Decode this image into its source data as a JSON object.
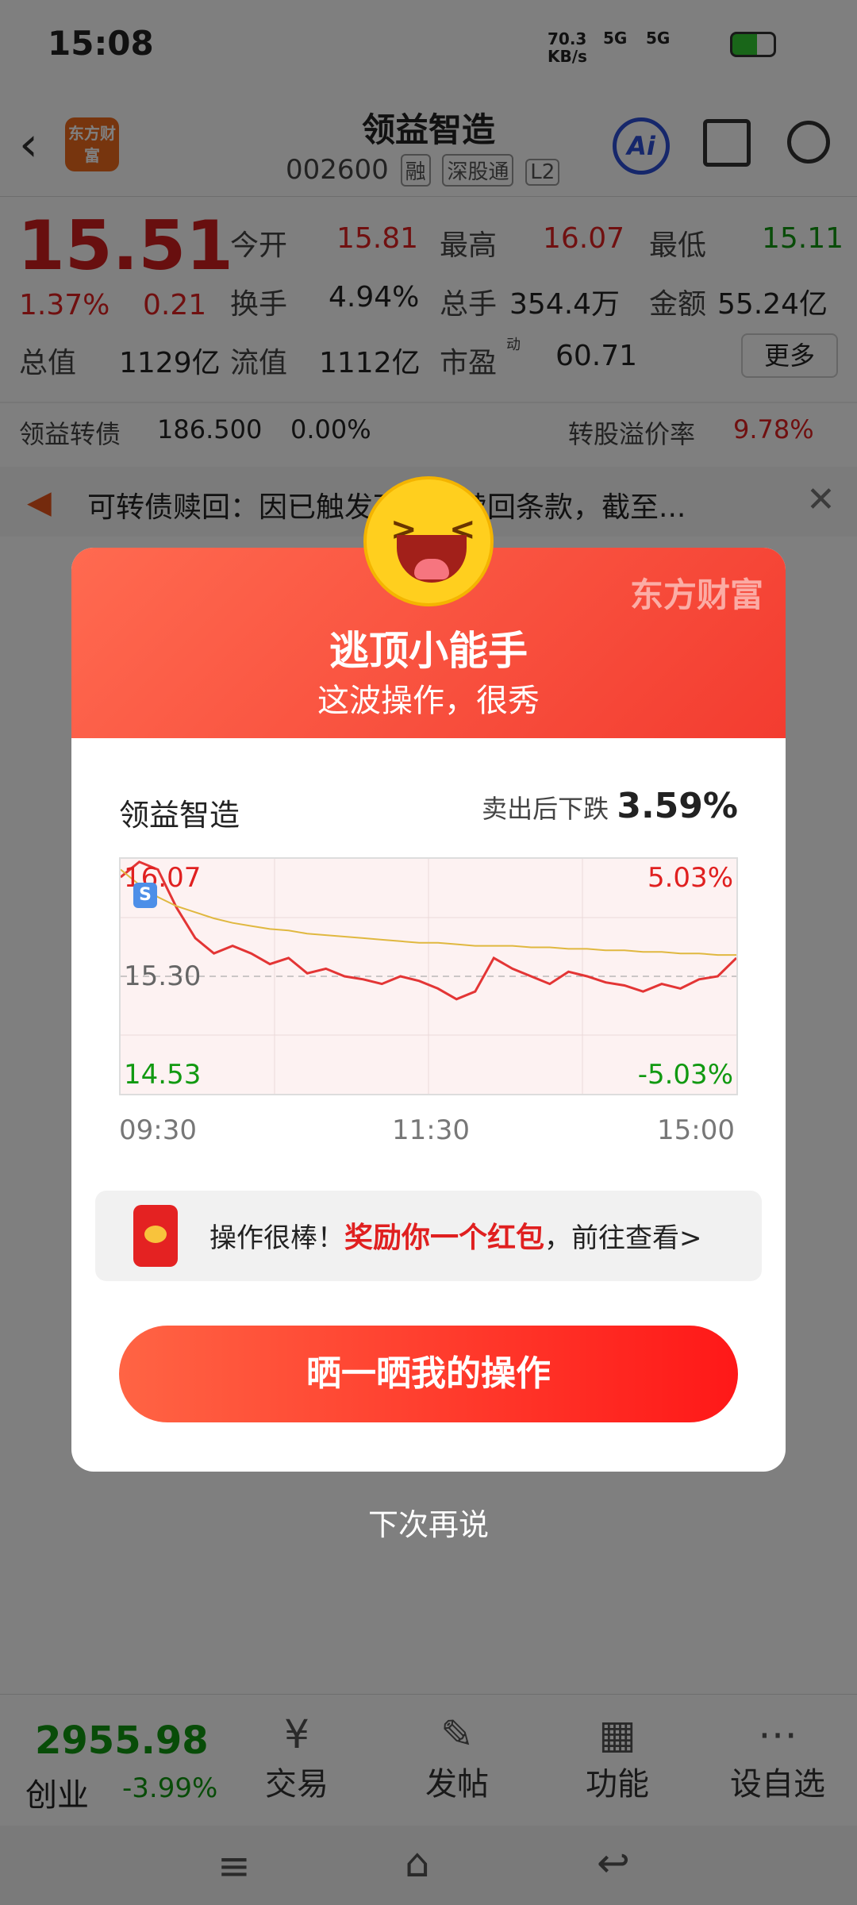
{
  "status_bar": {
    "time": "15:08",
    "net_speed": "70.3 KB/s",
    "sig1": "5G",
    "sig2": "5G"
  },
  "header": {
    "logo": "东方财富",
    "stock_name": "领益智造",
    "stock_code": "002600",
    "tags": [
      "融",
      "深股通",
      "L2"
    ],
    "ai_label": "Ai"
  },
  "quote": {
    "price": "15.51",
    "pct": "1.37%",
    "chg": "0.21",
    "open_label": "今开",
    "open": "15.81",
    "high_label": "最高",
    "high": "16.07",
    "low_label": "最低",
    "low": "15.11",
    "turnover_label": "换手",
    "turnover": "4.94%",
    "vol_label": "总手",
    "vol": "354.4万",
    "amount_label": "金额",
    "amount": "55.24亿",
    "mktcap_label": "总值",
    "mktcap": "1129亿",
    "float_label": "流值",
    "float": "1112亿",
    "pe_label": "市盈",
    "pe_sup": "动",
    "pe": "60.71",
    "more": "更多"
  },
  "bond": {
    "label": "领益转债",
    "price": "186.500",
    "pct": "0.00%",
    "prem_label": "转股溢价率",
    "prem": "9.78%"
  },
  "notice": {
    "text": "可转债赎回：因已触发可转债赎回条款，截至..."
  },
  "modal": {
    "brand": "东方财富",
    "title": "逃顶小能手",
    "subtitle": "这波操作，很秀",
    "stock": "领益智造",
    "drop_label": "卖出后下跌",
    "drop_value": "3.59%",
    "chart_high": "16.07",
    "chart_low": "14.53",
    "chart_high_pct": "5.03%",
    "chart_low_pct": "-5.03%",
    "chart_mid": "15.30",
    "chart_marker": "S",
    "times": [
      "09:30",
      "11:30",
      "15:00"
    ],
    "hint_pre": "操作很棒！",
    "hint_highlight": "奖励你一个红包",
    "hint_post": "，前往查看>",
    "share_button": "晒一晒我的操作",
    "later": "下次再说"
  },
  "nav": {
    "index_value": "2955.98",
    "index_name": "创业",
    "index_pct": "-3.99%",
    "items": [
      "交易",
      "发帖",
      "功能",
      "设自选"
    ]
  },
  "chart_data": {
    "type": "line",
    "x_labels": [
      "09:30",
      "11:30",
      "15:00"
    ],
    "ylim": [
      14.53,
      16.07
    ],
    "series": [
      {
        "values": [
          15.95,
          16.05,
          16.0,
          15.75,
          15.55,
          15.45,
          15.5,
          15.45,
          15.38,
          15.42,
          15.32,
          15.35,
          15.3,
          15.28,
          15.25,
          15.3,
          15.27,
          15.22,
          15.15,
          15.2,
          15.42,
          15.35,
          15.3,
          15.25,
          15.33,
          15.3,
          15.26,
          15.24,
          15.2,
          15.25,
          15.22,
          15.28,
          15.3,
          15.42
        ]
      },
      {
        "values": [
          16.0,
          15.9,
          15.82,
          15.76,
          15.72,
          15.68,
          15.65,
          15.63,
          15.61,
          15.6,
          15.58,
          15.57,
          15.56,
          15.55,
          15.54,
          15.53,
          15.52,
          15.52,
          15.51,
          15.5,
          15.5,
          15.5,
          15.49,
          15.49,
          15.48,
          15.48,
          15.47,
          15.47,
          15.46,
          15.46,
          15.45,
          15.45,
          15.44,
          15.44
        ]
      }
    ],
    "colors": [
      "#e33535",
      "#e0b840"
    ]
  }
}
